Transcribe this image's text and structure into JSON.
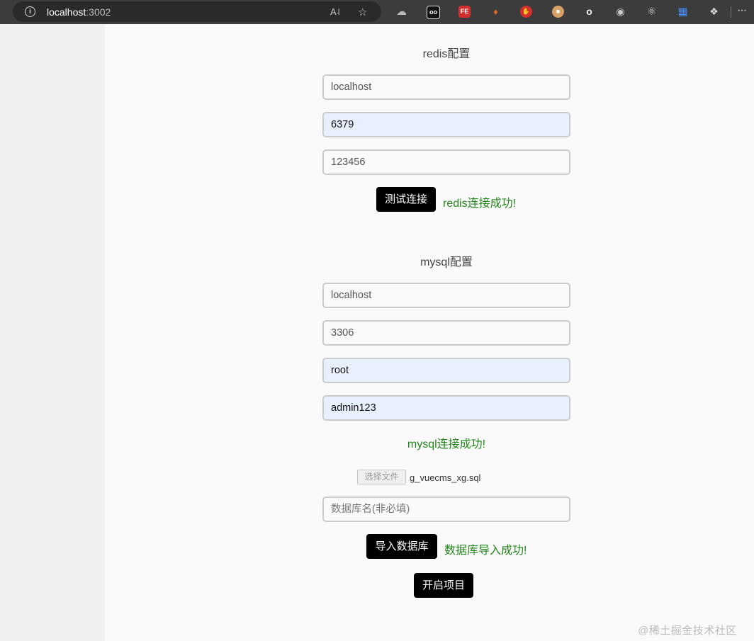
{
  "browser": {
    "url_host": "localhost",
    "url_port": ":3002"
  },
  "redis": {
    "heading": "redis配置",
    "host_value": "localhost",
    "port_value": "6379",
    "password_value": "123456",
    "test_button": "测试连接",
    "status": "redis连接成功!"
  },
  "mysql": {
    "heading": "mysql配置",
    "host_value": "localhost",
    "port_value": "3306",
    "user_value": "root",
    "password_value": "admin123",
    "status": "mysql连接成功!"
  },
  "import": {
    "file_button": "选择文件",
    "file_name": "g_vuecms_xg.sql",
    "dbname_placeholder": "数据库名(非必填)",
    "import_button": "导入数据库",
    "status": "数据库导入成功!"
  },
  "start_button": "开启项目",
  "watermark": "@稀土掘金技术社区",
  "icons": [
    "info-icon",
    "read-aloud-icon",
    "favorite-star-icon",
    "extension-icon",
    "more-icon"
  ],
  "colors": {
    "success": "#22861a",
    "button": "#000000",
    "autofill": "#e8f0fe"
  }
}
